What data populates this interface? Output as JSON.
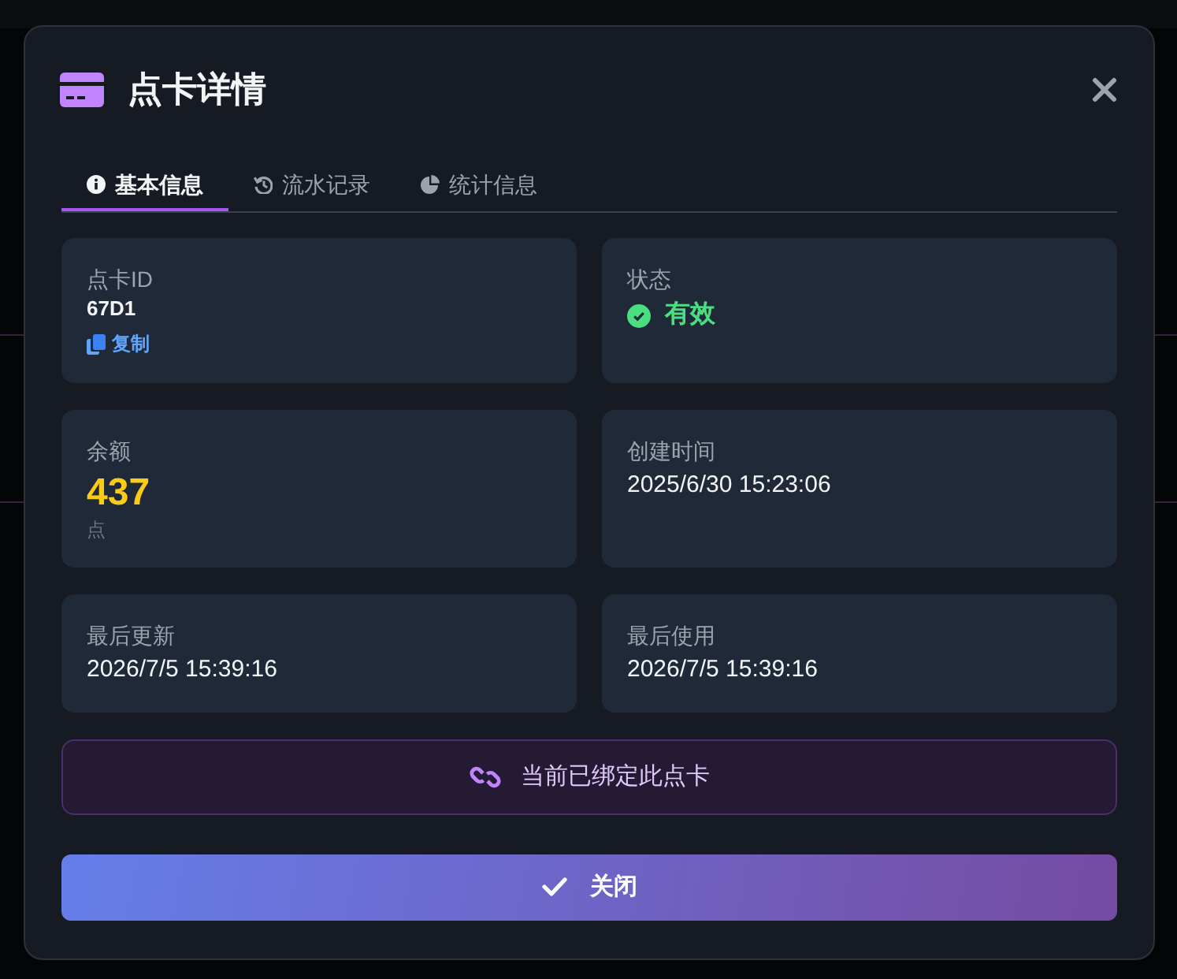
{
  "dialog": {
    "title": "点卡详情"
  },
  "tabs": [
    {
      "label": "基本信息",
      "selected": true
    },
    {
      "label": "流水记录",
      "selected": false
    },
    {
      "label": "统计信息",
      "selected": false
    }
  ],
  "fields": [
    {
      "kind": "id",
      "label": "点卡ID",
      "value": "67D1",
      "action": "复制"
    },
    {
      "kind": "status",
      "label": "状态",
      "value": "有效",
      "ok": true
    },
    {
      "kind": "balance",
      "label": "余额",
      "value": "437",
      "unit": "点"
    },
    {
      "kind": "text",
      "label": "创建时间",
      "value": "2025/6/30 15:23:06"
    },
    {
      "kind": "text",
      "label": "最后更新",
      "value": "2026/7/5 15:39:16"
    },
    {
      "kind": "text",
      "label": "最后使用",
      "value": "2026/7/5 15:39:16"
    }
  ],
  "bound_notice": {
    "text": "当前已绑定此点卡"
  },
  "close_button": {
    "label": "关闭"
  }
}
